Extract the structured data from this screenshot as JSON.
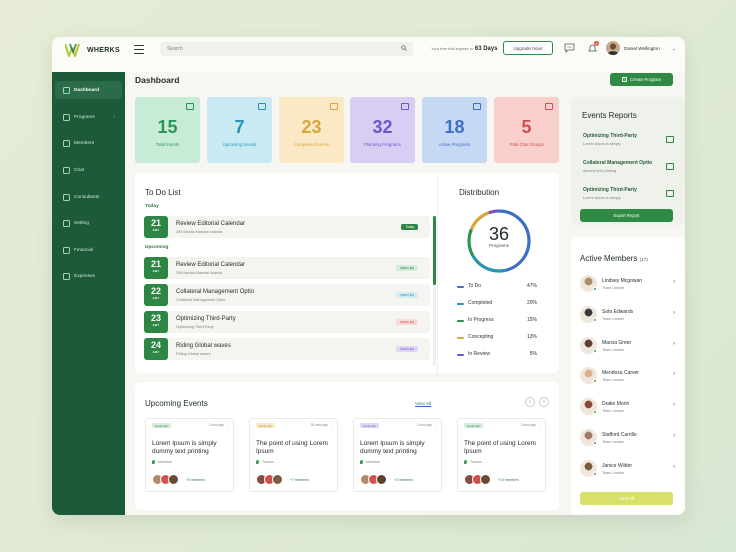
{
  "brand": {
    "name": "WHERKS"
  },
  "topbar": {
    "search_placeholder": "Search",
    "trial_prefix": "Your free trial expires in",
    "trial_days": "63 Days",
    "upgrade_label": "Upgrade Now!",
    "notification_count": "4",
    "user_name": "Daniel Wellington"
  },
  "sidebar": {
    "items": [
      {
        "label": "Dashboard"
      },
      {
        "label": "Programs"
      },
      {
        "label": "Members"
      },
      {
        "label": "Chat"
      },
      {
        "label": "Consultants"
      },
      {
        "label": "Setting"
      },
      {
        "label": "Financial"
      },
      {
        "label": "Expenses"
      }
    ]
  },
  "page": {
    "title": "Dashboard",
    "create_label": "Create Program"
  },
  "stats": [
    {
      "value": "15",
      "label": "Total Events",
      "bg": "#c6ecd7",
      "color": "#2b9553"
    },
    {
      "value": "7",
      "label": "Upcoming Events",
      "bg": "#c9eaf3",
      "color": "#2993b5"
    },
    {
      "value": "23",
      "label": "Completed Events",
      "bg": "#fbe9c6",
      "color": "#d9a43a"
    },
    {
      "value": "32",
      "label": "Planning Programs",
      "bg": "#d9cdf4",
      "color": "#6f56c5"
    },
    {
      "value": "18",
      "label": "Active Programs",
      "bg": "#c5d9f4",
      "color": "#3d6fc2"
    },
    {
      "value": "5",
      "label": "Total Chat Groups",
      "bg": "#f9cfcc",
      "color": "#d2514c"
    }
  ],
  "todo": {
    "title": "To Do List",
    "today_label": "Today",
    "upcoming_label": "Upcoming",
    "today": [
      {
        "day": "21",
        "month": "ABY",
        "title": "Review Editorial Calendar",
        "sub": "299 Manila Marshal Islands",
        "pill": "Today",
        "pill_bg": "#2d8644",
        "pill_fg": "#ffffff"
      }
    ],
    "upcoming": [
      {
        "day": "21",
        "month": "ABY",
        "title": "Review Editorial Calendar",
        "sub": "299 Manila Marshal Islands",
        "pill": "lpsum lpq",
        "pill_bg": "#d5eedc",
        "pill_fg": "#2e7a45"
      },
      {
        "day": "22",
        "month": "ABY",
        "title": "Collateral Management Optio",
        "sub": "Collateral Management Optio",
        "pill": "lpsum lpq",
        "pill_bg": "#d3edf5",
        "pill_fg": "#2a8db0"
      },
      {
        "day": "23",
        "month": "ABY",
        "title": "Optimizing Third-Party",
        "sub": "Optimizing Third-Party",
        "pill": "lpsum lpq",
        "pill_bg": "#fbdad6",
        "pill_fg": "#c9514c"
      },
      {
        "day": "24",
        "month": "ABY",
        "title": "Riding Global waves",
        "sub": "Riding Global waves",
        "pill": "lpsum lpq",
        "pill_bg": "#e0d7f6",
        "pill_fg": "#6f56c5"
      }
    ]
  },
  "distribution": {
    "title": "Distribution",
    "total": "36",
    "total_label": "Programs",
    "items": [
      {
        "label": "To Do",
        "pct": "47%",
        "color": "#3d6fc2"
      },
      {
        "label": "Completed",
        "pct": "20%",
        "color": "#2993b5"
      },
      {
        "label": "In Progress",
        "pct": "15%",
        "color": "#2b9553"
      },
      {
        "label": "Concepting",
        "pct": "13%",
        "color": "#d9a43a"
      },
      {
        "label": "In Review",
        "pct": "5%",
        "color": "#6f56c5"
      }
    ]
  },
  "events": {
    "title": "Upcoming Events",
    "view_all": "View All",
    "cards": [
      {
        "tag": "lpsum lpq",
        "tag_bg": "#d5eedc",
        "tag_fg": "#2e7a45",
        "ago": "1 hour ago",
        "title": "Lorem Ipsum is simply dummy text printing",
        "loc": "Montreal",
        "members": "+5 members"
      },
      {
        "tag": "lpsum lpq",
        "tag_bg": "#fbe9c6",
        "tag_fg": "#b5862a",
        "ago": "30 mins ago",
        "title": "The point of using Lorem Ipsum",
        "loc": "Toronto",
        "members": "+7 members"
      },
      {
        "tag": "lpsum lpq",
        "tag_bg": "#e0d7f6",
        "tag_fg": "#6f56c5",
        "ago": "1 hour ago",
        "title": "Lorem Ipsum is simply dummy text printing",
        "loc": "Montreal",
        "members": "+3 members"
      },
      {
        "tag": "lpsum lpq",
        "tag_bg": "#d5eedc",
        "tag_fg": "#2e7a45",
        "ago": "2 hour ago",
        "title": "The point of using Lorem Ipsum",
        "loc": "Toronto",
        "members": "+10 members"
      }
    ]
  },
  "reports": {
    "title": "Events Reports",
    "items": [
      {
        "title": "Optimizing Third-Party",
        "sub": "Lorem ipsum is simply"
      },
      {
        "title": "Collateral Management Optio",
        "sub": "dummy text printing"
      },
      {
        "title": "Optimizing Third-Party",
        "sub": "Lorem ipsum is simply"
      }
    ],
    "export_label": "Export Report"
  },
  "members": {
    "title": "Active Members",
    "count": "(17)",
    "list": [
      {
        "name": "Lindsey Mcgowan",
        "role": "Team Leader",
        "color": "#b08a6a"
      },
      {
        "name": "Soto Edwards",
        "role": "Team Leader",
        "color": "#3a3a3a"
      },
      {
        "name": "Marcia Greer",
        "role": "Team Leader",
        "color": "#5b4030"
      },
      {
        "name": "Mendoza Carver",
        "role": "Team Leader",
        "color": "#d9b08a"
      },
      {
        "name": "Drake Morin",
        "role": "Team Leader",
        "color": "#8a4a3a"
      },
      {
        "name": "Stafford Carrillo",
        "role": "Team Leader",
        "color": "#a07a64"
      },
      {
        "name": "Janice Wilder",
        "role": "Team Leader",
        "color": "#7a5a40"
      }
    ],
    "view_all": "View All"
  }
}
